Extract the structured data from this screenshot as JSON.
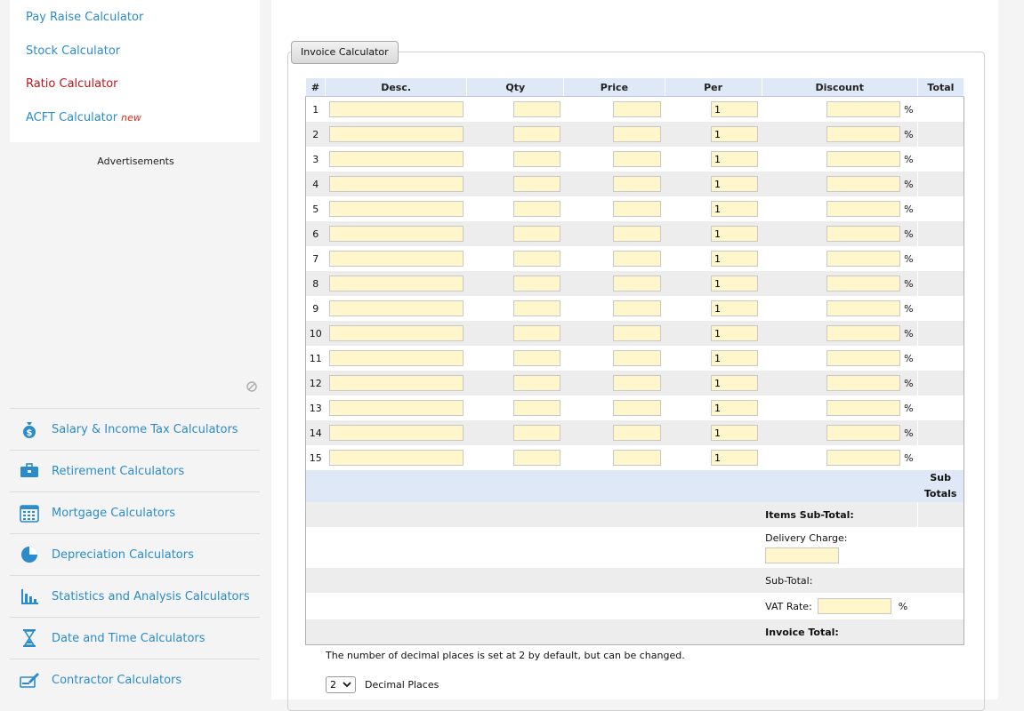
{
  "sidebar": {
    "links": [
      {
        "label": "Pay Raise Calculator",
        "active": false
      },
      {
        "label": "Stock Calculator",
        "active": false
      },
      {
        "label": "Ratio Calculator",
        "active": true
      },
      {
        "label": "ACFT Calculator",
        "active": false,
        "badge": "new"
      }
    ],
    "ads_label": "Advertisements",
    "categories": [
      {
        "label": "Salary & Income Tax Calculators",
        "icon": "money-bag-icon"
      },
      {
        "label": "Retirement Calculators",
        "icon": "briefcase-icon"
      },
      {
        "label": "Mortgage Calculators",
        "icon": "calendar-icon"
      },
      {
        "label": "Depreciation Calculators",
        "icon": "pie-chart-icon"
      },
      {
        "label": "Statistics and Analysis Calculators",
        "icon": "bar-chart-icon"
      },
      {
        "label": "Date and Time Calculators",
        "icon": "hourglass-icon"
      },
      {
        "label": "Contractor Calculators",
        "icon": "check-pen-icon"
      }
    ]
  },
  "calculator": {
    "tab_label": "Invoice Calculator",
    "columns": [
      "#",
      "Desc.",
      "Qty",
      "Price",
      "Per",
      "Discount",
      "Total"
    ],
    "rows": [
      {
        "num": "1",
        "per": "1"
      },
      {
        "num": "2",
        "per": "1"
      },
      {
        "num": "3",
        "per": "1"
      },
      {
        "num": "4",
        "per": "1"
      },
      {
        "num": "5",
        "per": "1"
      },
      {
        "num": "6",
        "per": "1"
      },
      {
        "num": "7",
        "per": "1"
      },
      {
        "num": "8",
        "per": "1"
      },
      {
        "num": "9",
        "per": "1"
      },
      {
        "num": "10",
        "per": "1"
      },
      {
        "num": "11",
        "per": "1"
      },
      {
        "num": "12",
        "per": "1"
      },
      {
        "num": "13",
        "per": "1"
      },
      {
        "num": "14",
        "per": "1"
      },
      {
        "num": "15",
        "per": "1"
      }
    ],
    "percent_symbol": "%",
    "sub_totals_header": "Sub\nTotals",
    "items_subtotal_label": "Items Sub-Total:",
    "delivery_label": "Delivery Charge:",
    "subtotal_label": "Sub-Total:",
    "vat_label": "VAT Rate:",
    "invoice_total_label": "Invoice Total:",
    "decimal_note": "The number of decimal places is set at 2 by default, but can be changed.",
    "decimal_value": "2",
    "decimal_label": "Decimal Places"
  },
  "colors": {
    "link": "#2a8ccb",
    "active_link": "#c0141b",
    "input_bg": "#fff6cc",
    "header_bg": "#dfe8f6"
  }
}
